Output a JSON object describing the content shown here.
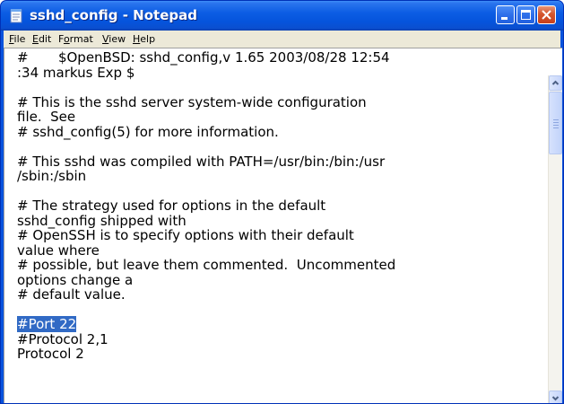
{
  "window": {
    "title": "sshd_config - Notepad",
    "icon": "notepad-icon",
    "controls": [
      "minimize-icon",
      "maximize-icon",
      "close-icon"
    ]
  },
  "menubar": {
    "items": [
      {
        "mnemonic": "F",
        "rest": "ile"
      },
      {
        "mnemonic": "E",
        "rest": "dit"
      },
      {
        "pre": "F",
        "mnemonic": "o",
        "rest": "rmat"
      },
      {
        "mnemonic": "V",
        "rest": "iew"
      },
      {
        "mnemonic": "H",
        "rest": "elp"
      }
    ]
  },
  "editor": {
    "lines": [
      "#       $OpenBSD: sshd_config,v 1.65 2003/08/28 12:54",
      ":34 markus Exp $",
      "",
      "# This is the sshd server system-wide configuration",
      "file.  See",
      "# sshd_config(5) for more information.",
      "",
      "# This sshd was compiled with PATH=/usr/bin:/bin:/usr",
      "/sbin:/sbin",
      "",
      "# The strategy used for options in the default",
      "sshd_config shipped with",
      "# OpenSSH is to specify options with their default",
      "value where",
      "# possible, but leave them commented.  Uncommented",
      "options change a",
      "# default value.",
      "",
      "#Port 22",
      "#Protocol 2,1",
      "Protocol 2"
    ],
    "selected_line": 18
  },
  "colors": {
    "titlebar": "#0554DC",
    "menubar": "#ECE9D8",
    "selection": "#316AC5",
    "close_button": "#D4562E"
  }
}
